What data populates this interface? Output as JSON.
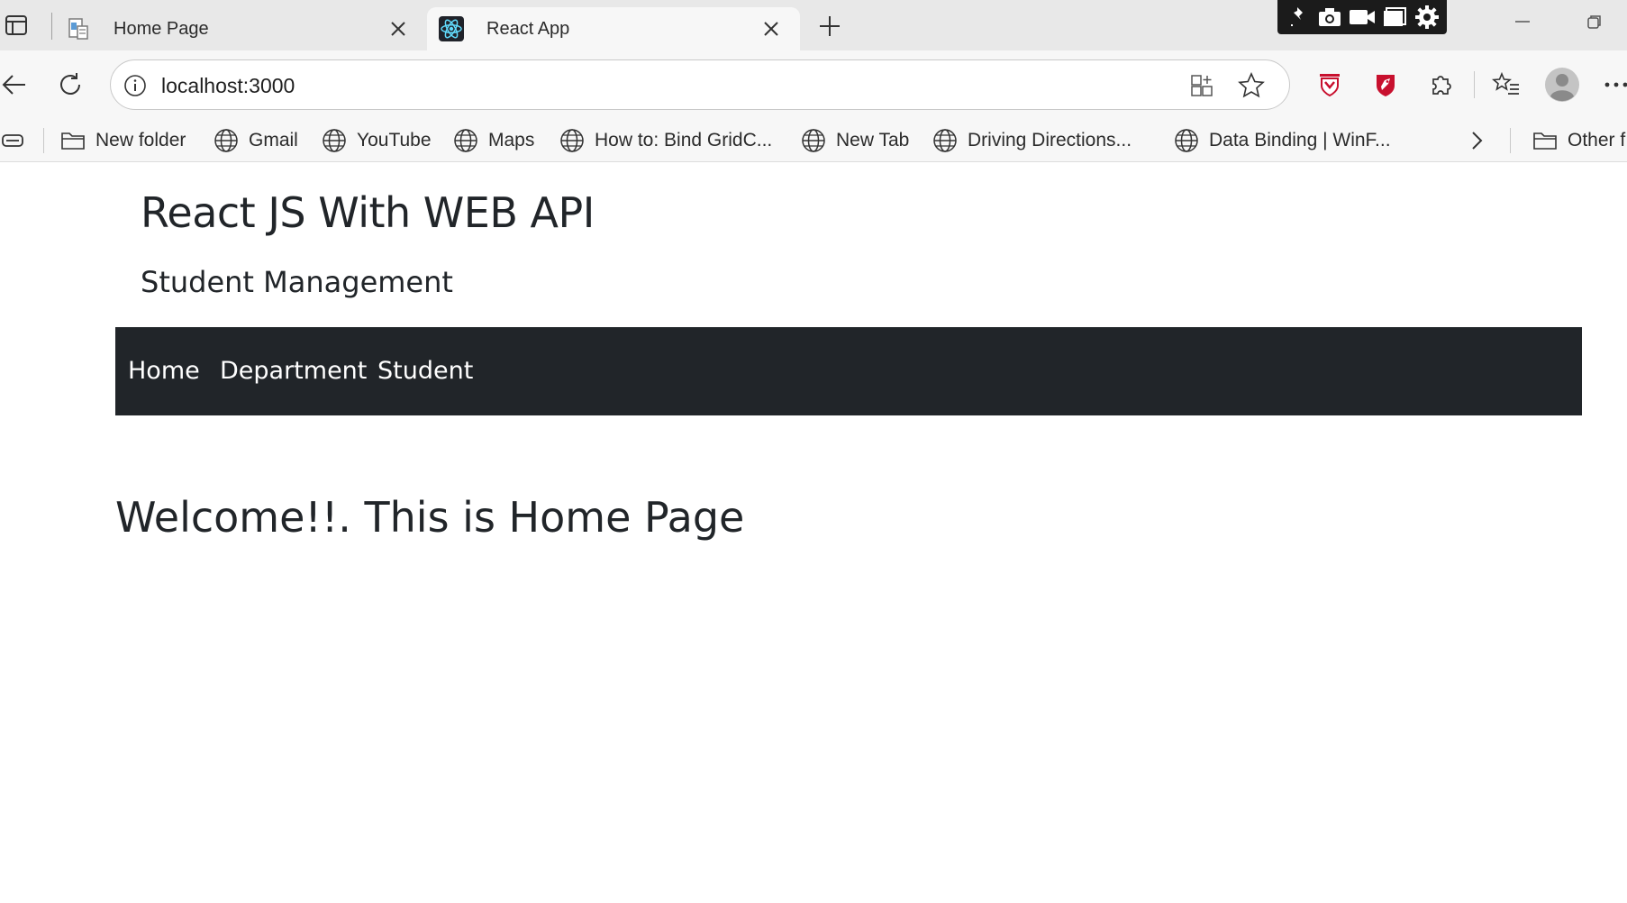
{
  "browser": {
    "tabs": [
      {
        "title": "Home Page",
        "favicon": "document-favicon-icon",
        "active": false
      },
      {
        "title": "React App",
        "favicon": "react-logo-icon",
        "active": true
      }
    ],
    "address": {
      "url": "localhost:3000"
    },
    "favorites": [
      {
        "label": "New folder",
        "icon": "folder-icon"
      },
      {
        "label": "Gmail",
        "icon": "globe-icon"
      },
      {
        "label": "YouTube",
        "icon": "globe-icon"
      },
      {
        "label": "Maps",
        "icon": "globe-icon"
      },
      {
        "label": "How to: Bind GridC...",
        "icon": "globe-icon"
      },
      {
        "label": "New Tab",
        "icon": "globe-icon"
      },
      {
        "label": "Driving Directions...",
        "icon": "globe-icon"
      },
      {
        "label": "Data Binding | WinF...",
        "icon": "globe-icon"
      }
    ],
    "other_favorites": "Other f"
  },
  "page": {
    "title": "React JS With WEB API",
    "subtitle": "Student Management",
    "nav": [
      "Home",
      "Department",
      "Student"
    ],
    "heading": "Welcome!!. This is Home Page"
  },
  "colors": {
    "navbar_bg": "#212529",
    "text": "#212529",
    "tabstrip_bg": "#e8e8e8",
    "toolbar_bg": "#f7f7f7",
    "extension_red": "#c8102e"
  }
}
